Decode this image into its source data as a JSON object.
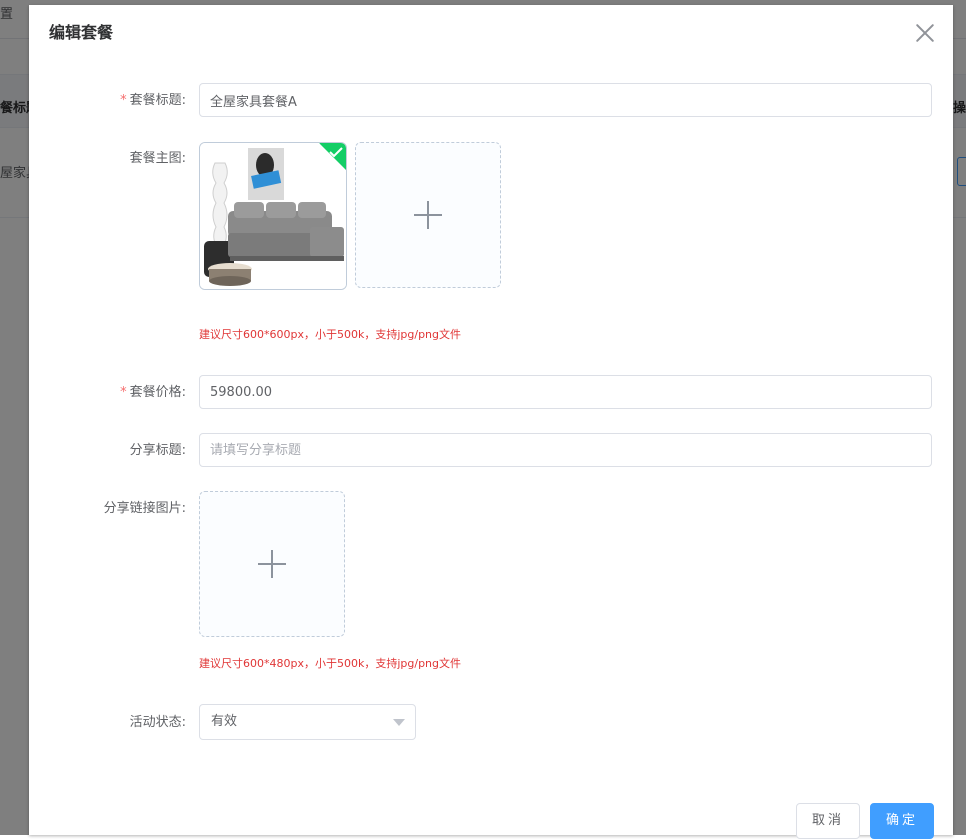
{
  "background": {
    "top_text": "置",
    "table_header_left": "餐标题",
    "table_header_right": "操",
    "row_cell_left": "屋家具"
  },
  "dialog": {
    "title": "编辑套餐",
    "close_icon": "close-icon",
    "required_mark": "*",
    "fields": {
      "title": {
        "label": "套餐标题:",
        "value": "全屋家具套餐A"
      },
      "main_image": {
        "label": "套餐主图:",
        "hint": "建议尺寸600*600px，小于500k，支持jpg/png文件"
      },
      "price": {
        "label": "套餐价格:",
        "value": "59800.00"
      },
      "share_title": {
        "label": "分享标题:",
        "value": "",
        "placeholder": "请填写分享标题"
      },
      "share_image": {
        "label": "分享链接图片:",
        "hint": "建议尺寸600*480px，小于500k，支持jpg/png文件"
      },
      "status": {
        "label": "活动状态:",
        "selected": "有效"
      }
    },
    "footer": {
      "cancel_label": "取消",
      "ok_label": "确定"
    }
  },
  "colors": {
    "primary": "#409eff",
    "required": "#f56c6c",
    "hint": "#e03636",
    "success": "#13ce66"
  }
}
